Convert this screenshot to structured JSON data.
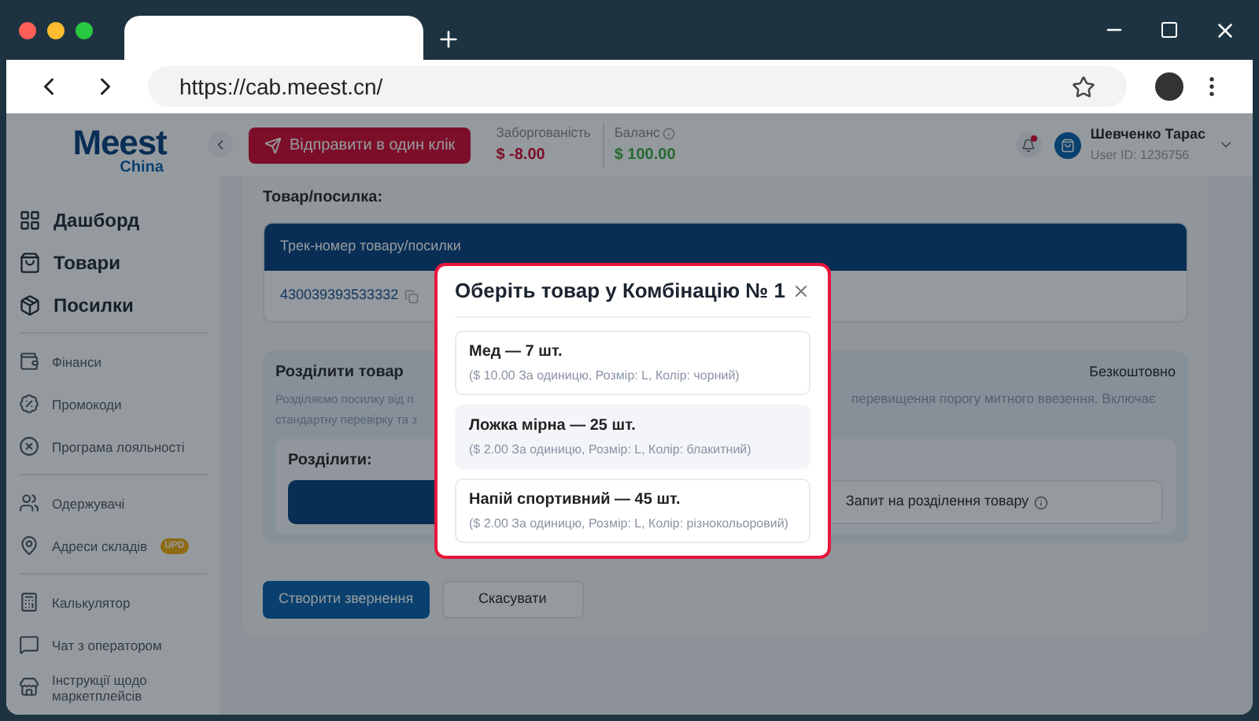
{
  "browser": {
    "url": "https://cab.meest.cn/"
  },
  "header": {
    "logo": {
      "name": "Meest",
      "sub": "China"
    },
    "send_button": "Відправити в один клік",
    "debt": {
      "label": "Заборгованість",
      "value": "$ -8.00"
    },
    "balance": {
      "label": "Баланс",
      "value": "$ 100.00"
    },
    "notifications": {
      "unread": true
    },
    "user": {
      "name": "Шевченко Тарас",
      "id": "User ID: 1236756"
    }
  },
  "sidebar": {
    "groups": [
      {
        "kind": "main",
        "items": [
          {
            "label": "Дашборд"
          },
          {
            "label": "Товари"
          },
          {
            "label": "Посилки"
          }
        ]
      },
      {
        "kind": "minor",
        "items": [
          {
            "label": "Фінанси"
          },
          {
            "label": "Промокоди"
          },
          {
            "label": "Програма лояльності"
          }
        ]
      },
      {
        "kind": "minor",
        "items": [
          {
            "label": "Одержувачі"
          },
          {
            "label": "Адреси складів",
            "badge": "UPD"
          }
        ]
      },
      {
        "kind": "minor",
        "items": [
          {
            "label": "Калькулятор"
          },
          {
            "label": "Чат з оператором"
          },
          {
            "label": "Інструкції щодо маркетплейсів"
          }
        ]
      }
    ]
  },
  "content": {
    "section_title": "Товар/посилка:",
    "table": {
      "column": "Трек-номер товару/посилки",
      "track": "430039393533332"
    },
    "split": {
      "title": "Розділити товар",
      "price": "Безкоштовно",
      "description_left": [
        "Розділяємо посилку від п",
        "стандартну перевірку та з"
      ],
      "description_right": "перевищення порогу митного ввезення. Включає",
      "label": "Розділити:",
      "request_button": "Запит на розділення товару"
    },
    "buttons": [
      {
        "label": "Створити звернення",
        "kind": "primary"
      },
      {
        "label": "Скасувати",
        "kind": "secondary"
      }
    ]
  },
  "modal": {
    "title": "Оберіть товар у Комбінацію № 1",
    "items": [
      {
        "name": "Мед — 7 шт.",
        "details": "($ 10.00 За одиницю, Розмір: L, Колір: чорний)",
        "selected": false
      },
      {
        "name": "Ложка мірна — 25 шт.",
        "details": "($ 2.00 За одиницю, Розмір: L, Колір: блакитний)",
        "selected": true
      },
      {
        "name": "Напій спортивний — 45 шт.",
        "details": "($ 2.00 За одиницю, Розмір: L, Колір: різнокольоровий)",
        "selected": false
      }
    ]
  }
}
